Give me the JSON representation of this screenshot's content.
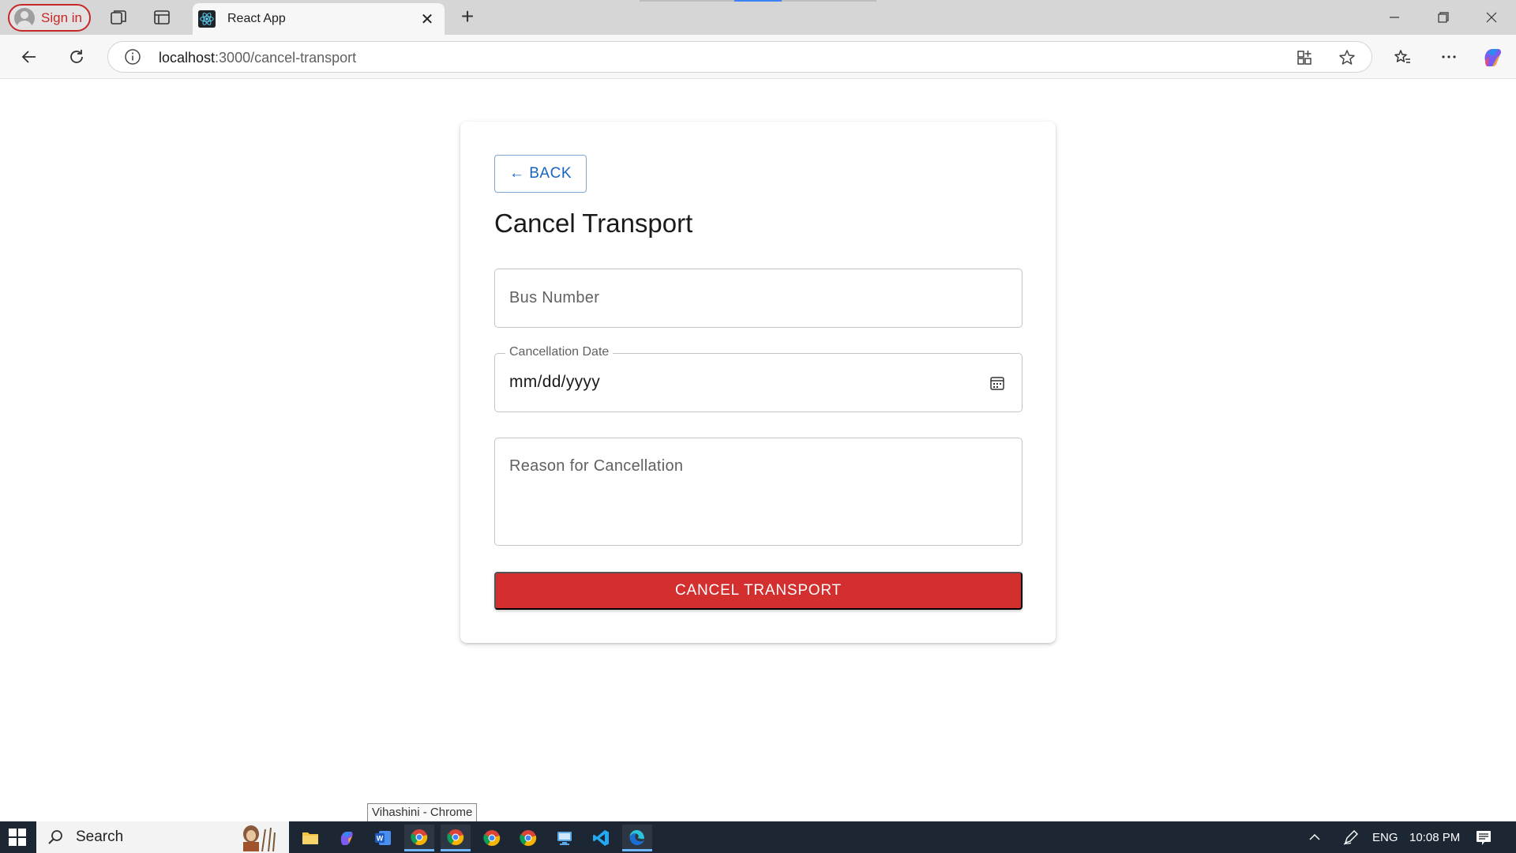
{
  "browser": {
    "signin_label": "Sign in",
    "tab_title": "React App",
    "url_host": "localhost",
    "url_path": ":3000/cancel-transport",
    "icons": [
      "workspaces-icon",
      "tab-actions-icon",
      "react-favicon-icon",
      "close-icon",
      "new-tab-icon",
      "minimize-icon",
      "restore-icon",
      "window-close-icon",
      "back-icon",
      "refresh-icon",
      "site-info-icon",
      "app-available-icon",
      "favorite-star-icon",
      "favorites-icon",
      "more-icon",
      "copilot-icon"
    ]
  },
  "page": {
    "back_label": "← BACK",
    "title": "Cancel Transport",
    "bus_number_placeholder": "Bus Number",
    "date_label": "Cancellation Date",
    "date_value": "mm/dd/yyyy",
    "reason_placeholder": "Reason for Cancellation",
    "submit_label": "CANCEL TRANSPORT",
    "accent_color": "#d32f2f",
    "back_color": "#1565c0"
  },
  "tooltip": "Vihashini - Chrome",
  "taskbar": {
    "search_label": "Search",
    "language": "ENG",
    "time": "10:08 PM",
    "apps": [
      "file-explorer-icon",
      "copilot-app-icon",
      "word-icon",
      "chrome-icon",
      "chrome-icon",
      "chrome-icon",
      "chrome-icon",
      "network-app-icon",
      "vscode-icon",
      "edge-icon"
    ]
  }
}
